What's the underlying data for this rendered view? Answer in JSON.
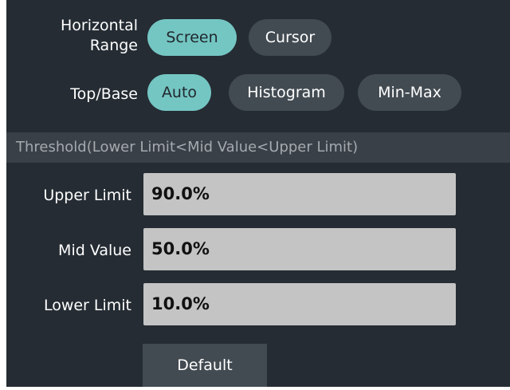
{
  "horizontal_range": {
    "label_line1": "Horizontal",
    "label_line2": "Range",
    "options": [
      "Screen",
      "Cursor"
    ],
    "selected": "Screen"
  },
  "top_base": {
    "label": "Top/Base",
    "options": [
      "Auto",
      "Histogram",
      "Min-Max"
    ],
    "selected": "Auto"
  },
  "threshold": {
    "header": "Threshold(Lower Limit<Mid Value<Upper Limit)",
    "upper_limit_label": "Upper Limit",
    "upper_limit_value": "90.0%",
    "mid_value_label": "Mid Value",
    "mid_value_value": "50.0%",
    "lower_limit_label": "Lower Limit",
    "lower_limit_value": "10.0%"
  },
  "default_button_label": "Default",
  "colors": {
    "panel_bg": "#252c33",
    "accent_selected": "#74c6c3",
    "unselected_pill": "#434b52",
    "section_bar": "#394047",
    "field_bg": "#c4c4c4"
  }
}
